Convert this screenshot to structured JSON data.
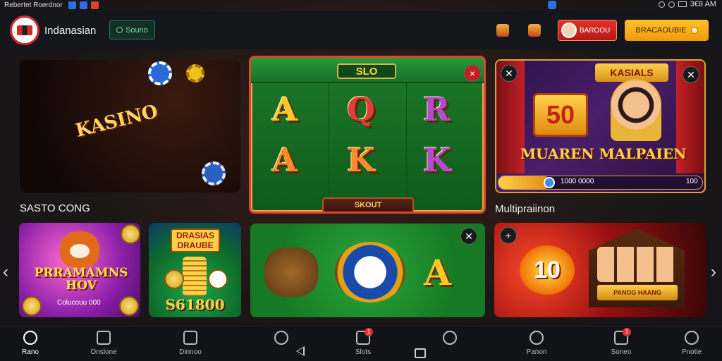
{
  "status_bar": {
    "title": "Rebertet Roerdnor",
    "time": "3€8 AM"
  },
  "header": {
    "brand": "Indanasian",
    "search_label": "Souno",
    "deposit_label": "BAROOU",
    "register_label": "BRACAOUBIE"
  },
  "cards": {
    "roulette": {
      "wheel_text": "KASINO",
      "label": "SASTO CONG"
    },
    "slot": {
      "title": "SLO",
      "symbols": [
        "A",
        "Q",
        "R",
        "A",
        "K",
        "K"
      ],
      "spin_label": "SKOUT"
    },
    "multiplayer": {
      "banner": "KASIALS",
      "big_number": "50",
      "game_title": "MUAREN MALPAIEN",
      "label": "Multipraiinon",
      "bar_text": "1000 0000",
      "bar_right": "100"
    },
    "fox": {
      "title": "PRRAMAMNS HOV",
      "subtitle": "Colucouu 000"
    },
    "coins": {
      "sign": "DRASIAS DRAUBE",
      "amount": "S61800"
    },
    "bunny": {
      "symbol": "A"
    },
    "houses": {
      "number": "10",
      "sign": "PANOG HAANG"
    }
  },
  "bottom_nav": [
    {
      "label": "Rano",
      "icon": "home-icon",
      "active": true
    },
    {
      "label": "Onslone",
      "icon": "casino-icon",
      "active": false
    },
    {
      "label": "Dinnoo",
      "icon": "games-icon",
      "active": false
    },
    {
      "label": "",
      "icon": "search-icon",
      "active": false
    },
    {
      "label": "Slots",
      "icon": "slots-icon",
      "active": false,
      "badge": "1"
    },
    {
      "label": "",
      "icon": "live-icon",
      "active": false
    },
    {
      "label": "Panon",
      "icon": "favorites-icon",
      "active": false
    },
    {
      "label": "Soneo",
      "icon": "promo-icon",
      "active": false,
      "badge": "1"
    },
    {
      "label": "Pnotie",
      "icon": "settings-icon",
      "active": false
    }
  ],
  "colors": {
    "accent_red": "#d3292a",
    "accent_gold": "#ffc22b",
    "slot_green": "#1c7a2a"
  }
}
